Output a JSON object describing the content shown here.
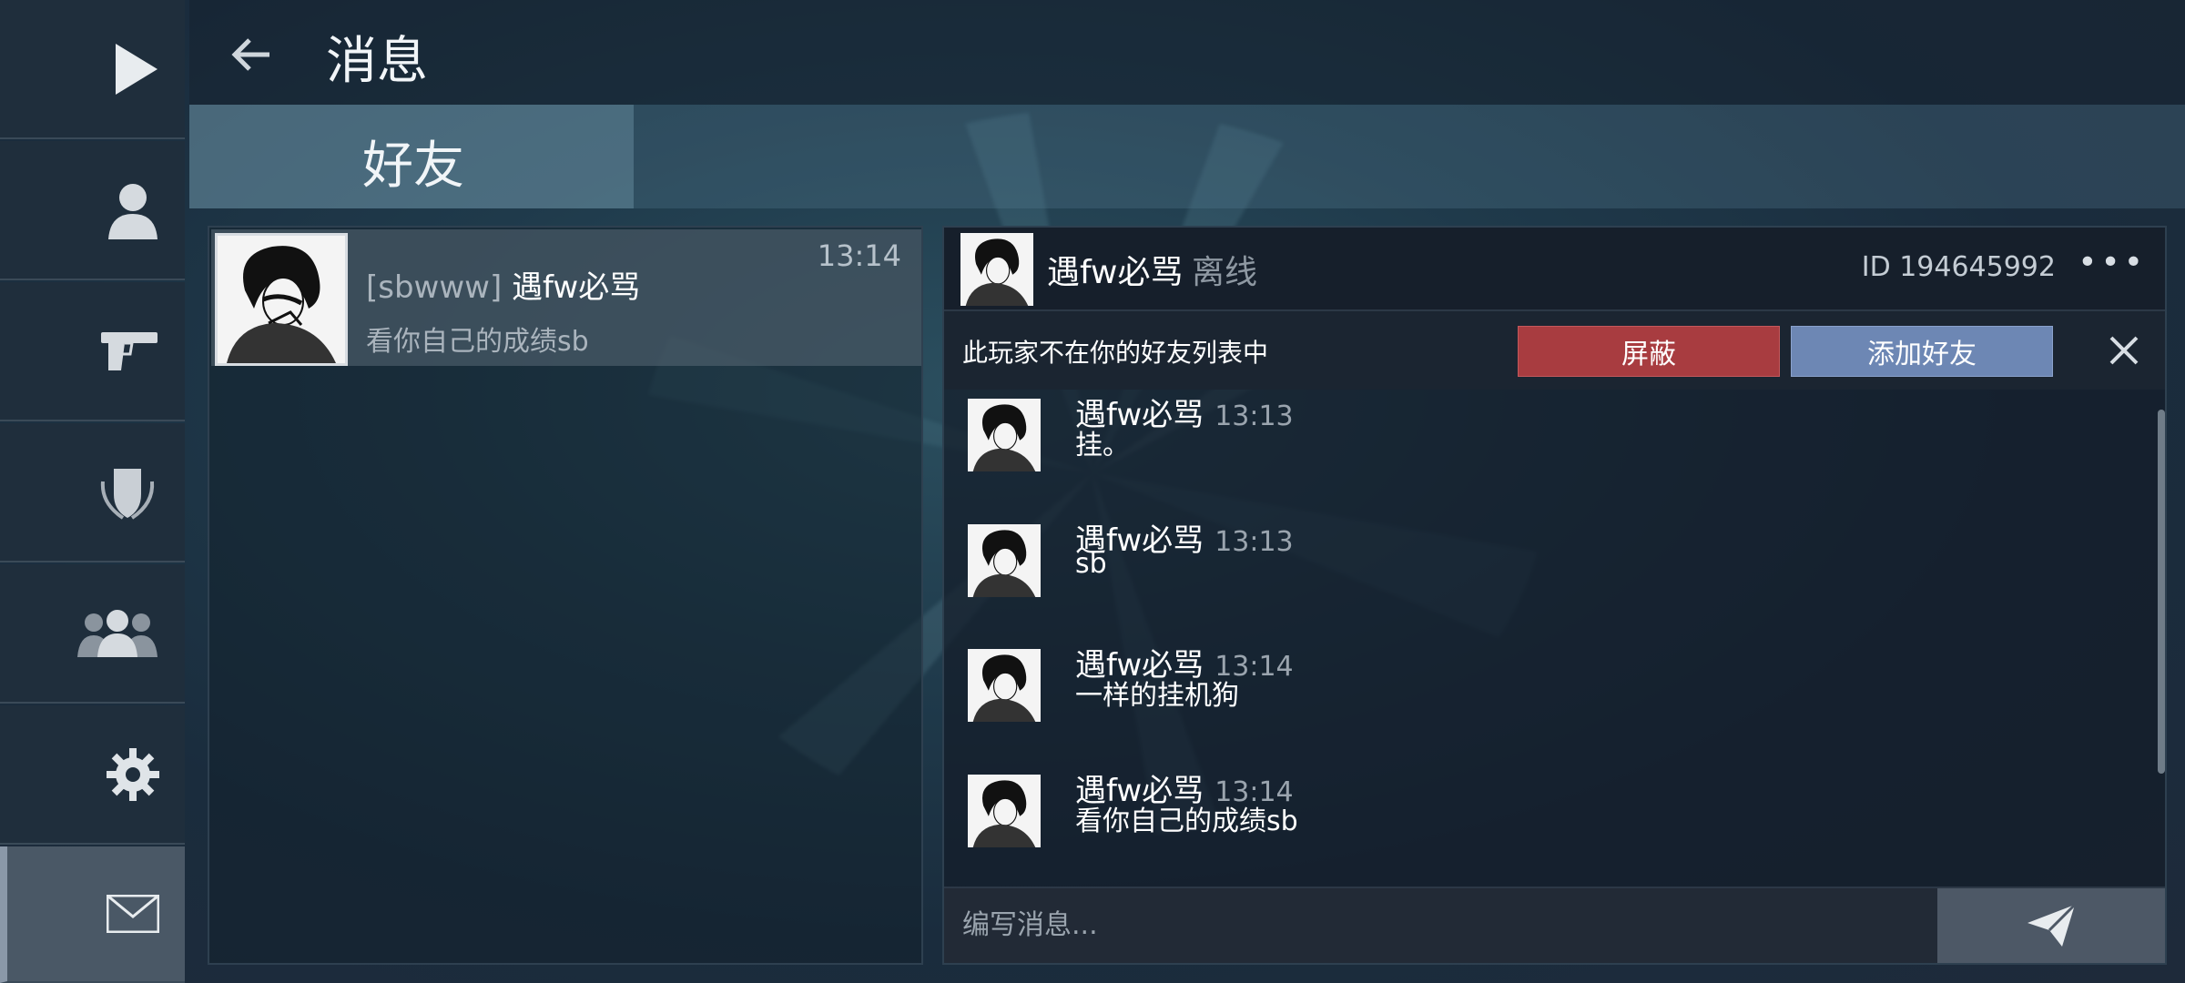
{
  "sidebar": {
    "items": [
      {
        "icon": "play-icon"
      },
      {
        "icon": "profile-icon"
      },
      {
        "icon": "pistol-icon"
      },
      {
        "icon": "shield-icon"
      },
      {
        "icon": "friends-icon"
      },
      {
        "icon": "gear-icon"
      },
      {
        "icon": "mail-icon",
        "active": true
      }
    ]
  },
  "header": {
    "title": "消息",
    "back_icon": "back-arrow-icon"
  },
  "tabs": {
    "friends_label": "好友"
  },
  "conversations": [
    {
      "tag": "[sbwww]",
      "name": "遇fw必骂",
      "preview": "看你自己的成绩sb",
      "time": "13:14"
    }
  ],
  "chat": {
    "name": "遇fw必骂",
    "status": "离线",
    "id_label": "ID 194645992",
    "more_label": "•••",
    "notice": {
      "text": "此玩家不在你的好友列表中",
      "block_label": "屏蔽",
      "add_label": "添加好友"
    },
    "messages": [
      {
        "name": "遇fw必骂",
        "time": "13:13",
        "text": "挂。"
      },
      {
        "name": "遇fw必骂",
        "time": "13:13",
        "text": "sb"
      },
      {
        "name": "遇fw必骂",
        "time": "13:14",
        "text": "一样的挂机狗"
      },
      {
        "name": "遇fw必骂",
        "time": "13:14",
        "text": "看你自己的成绩sb"
      }
    ],
    "composer": {
      "placeholder": "编写消息..."
    }
  },
  "colors": {
    "block_button": "#a83c40",
    "add_button": "#6d87b4"
  }
}
